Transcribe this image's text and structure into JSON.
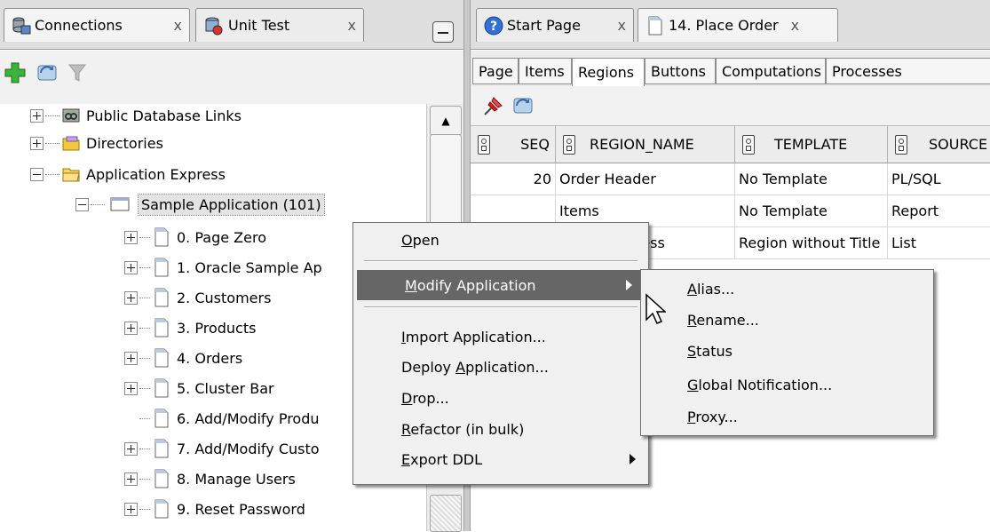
{
  "left_panel": {
    "tabs": [
      {
        "label": "Connections",
        "close": "x"
      },
      {
        "label": "Unit Test",
        "close": "x"
      }
    ],
    "toolbar_icons": [
      "add-icon",
      "refresh-icon",
      "filter-icon"
    ],
    "tree": [
      {
        "label": "Public Database Links",
        "level": 0,
        "state": "collapsed"
      },
      {
        "label": "Directories",
        "level": 0,
        "state": "collapsed"
      },
      {
        "label": "Application Express",
        "level": 0,
        "state": "expanded"
      },
      {
        "label": "Sample Application (101)",
        "level": 1,
        "state": "expanded",
        "selected": true
      },
      {
        "label": "0. Page Zero",
        "level": 2,
        "state": "collapsed"
      },
      {
        "label": "1. Oracle Sample Ap",
        "level": 2,
        "state": "collapsed"
      },
      {
        "label": "2. Customers",
        "level": 2,
        "state": "collapsed"
      },
      {
        "label": "3. Products",
        "level": 2,
        "state": "collapsed"
      },
      {
        "label": "4. Orders",
        "level": 2,
        "state": "collapsed"
      },
      {
        "label": "5. Cluster Bar",
        "level": 2,
        "state": "collapsed"
      },
      {
        "label": "6. Add/Modify Produ",
        "level": 2,
        "state": "leaf"
      },
      {
        "label": "7. Add/Modify Custo",
        "level": 2,
        "state": "collapsed"
      },
      {
        "label": "8. Manage Users",
        "level": 2,
        "state": "collapsed"
      },
      {
        "label": "9. Reset Password",
        "level": 2,
        "state": "collapsed"
      }
    ]
  },
  "right_panel": {
    "tabs": [
      {
        "label": "Start Page",
        "close": "x"
      },
      {
        "label": "14. Place Order",
        "close": "x"
      }
    ],
    "subtabs": [
      "Page",
      "Items",
      "Regions",
      "Buttons",
      "Computations",
      "Processes"
    ],
    "active_subtab": "Regions",
    "toolbar_icons": [
      "pin-icon",
      "refresh-icon"
    ],
    "columns": [
      "SEQ",
      "REGION_NAME",
      "TEMPLATE",
      "SOURCE"
    ],
    "rows": [
      [
        "20",
        "Order Header",
        "No Template",
        "PL/SQL"
      ],
      [
        "",
        "Items",
        "No Template",
        "Report"
      ],
      [
        "",
        "Order Progress",
        "Region without Title",
        "List"
      ]
    ]
  },
  "context_menu": {
    "items": [
      {
        "label": "Open",
        "mnemonic_index": 0
      },
      {
        "separator": true
      },
      {
        "label": "Modify Application",
        "mnemonic_index": 0,
        "submenu": true,
        "highlighted": true
      },
      {
        "separator": true
      },
      {
        "label": "Import Application...",
        "mnemonic_index": 0
      },
      {
        "label": "Deploy Application...",
        "mnemonic_index": 7
      },
      {
        "label": "Drop...",
        "mnemonic_index": 0
      },
      {
        "label": "Refactor (in bulk)",
        "mnemonic_index": 0
      },
      {
        "label": "Export DDL",
        "mnemonic_index": 0,
        "submenu": true
      }
    ]
  },
  "submenu": {
    "items": [
      {
        "label": "Alias...",
        "mnemonic_index": 0
      },
      {
        "label": "Rename...",
        "mnemonic_index": 0
      },
      {
        "label": "Status",
        "mnemonic_index": 0
      },
      {
        "label": "Global Notification...",
        "mnemonic_index": 0
      },
      {
        "label": "Proxy...",
        "mnemonic_index": 0
      }
    ]
  }
}
